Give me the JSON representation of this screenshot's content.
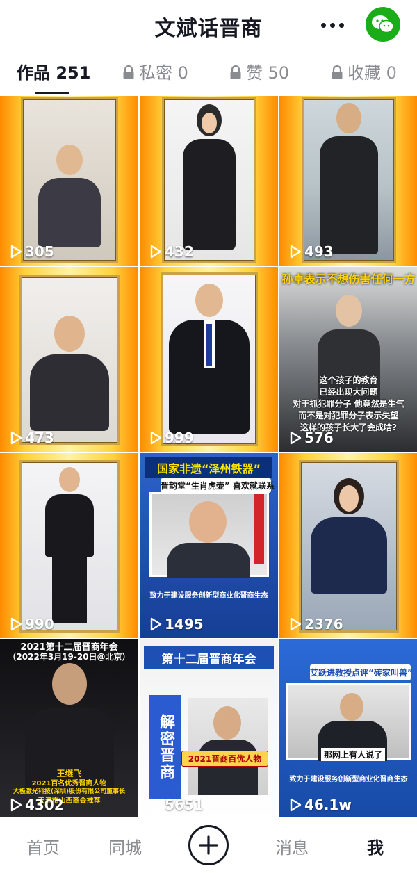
{
  "header": {
    "title": "文斌话晋商",
    "more_icon": "more-dots-icon",
    "wechat_icon": "wechat-icon",
    "wechat_color": "#1aad19"
  },
  "tabs": [
    {
      "label": "作品 251",
      "active": true
    },
    {
      "label": "私密 0",
      "locked": true
    },
    {
      "label": "赞 50",
      "locked": true
    },
    {
      "label": "收藏 0",
      "locked": true
    }
  ],
  "videos": [
    {
      "views": "305"
    },
    {
      "views": "432"
    },
    {
      "views": "493"
    },
    {
      "views": "473"
    },
    {
      "views": "999"
    },
    {
      "views": "576",
      "caption_top": "孙卓表示不想伤害任何一方",
      "caption_lines": [
        "这个孩子的教育",
        "已经出现大问题",
        "对于抓犯罪分子 他竟然是生气",
        "而不是对犯罪分子表示失望",
        "这样的孩子长大了会成啥?"
      ]
    },
    {
      "views": "990"
    },
    {
      "views": "1495",
      "banner": "国家非遗“泽州铁器”",
      "subbanner": "晋韵堂“生肖虎壶” 喜欢就联系",
      "footer": "致力于建设服务创新型商业化晋商生态"
    },
    {
      "views": "2376"
    },
    {
      "views": "4302",
      "headline1": "2021第十二届晋商年会",
      "headline2": "（2022年3月19-20日@北京）",
      "name": "王继飞",
      "bottom_lines": [
        "2021百名优秀晋商人物",
        "大极激光科技(深圳)股份有限公司董事长",
        "天津市山西商会推荐"
      ]
    },
    {
      "views": "5651",
      "headline": "第十二届晋商年会",
      "side_text": "解密晋商",
      "award": "2021晋商百优人物"
    },
    {
      "views": "46.1w",
      "banner": "艾跃进教授点评“砖家叫兽”",
      "subtitle": "那网上有人说了",
      "footer": "致力于建设服务创新型商业化晋商生态"
    }
  ],
  "bottom_nav": [
    {
      "label": "首页"
    },
    {
      "label": "同城"
    },
    {
      "label": "",
      "icon": "add-icon"
    },
    {
      "label": "消息"
    },
    {
      "label": "我",
      "active": true
    }
  ],
  "colors": {
    "accent_gold": "#c9a24b",
    "orange": "#f08a1c",
    "blue_banner": "#1e4fb3"
  }
}
